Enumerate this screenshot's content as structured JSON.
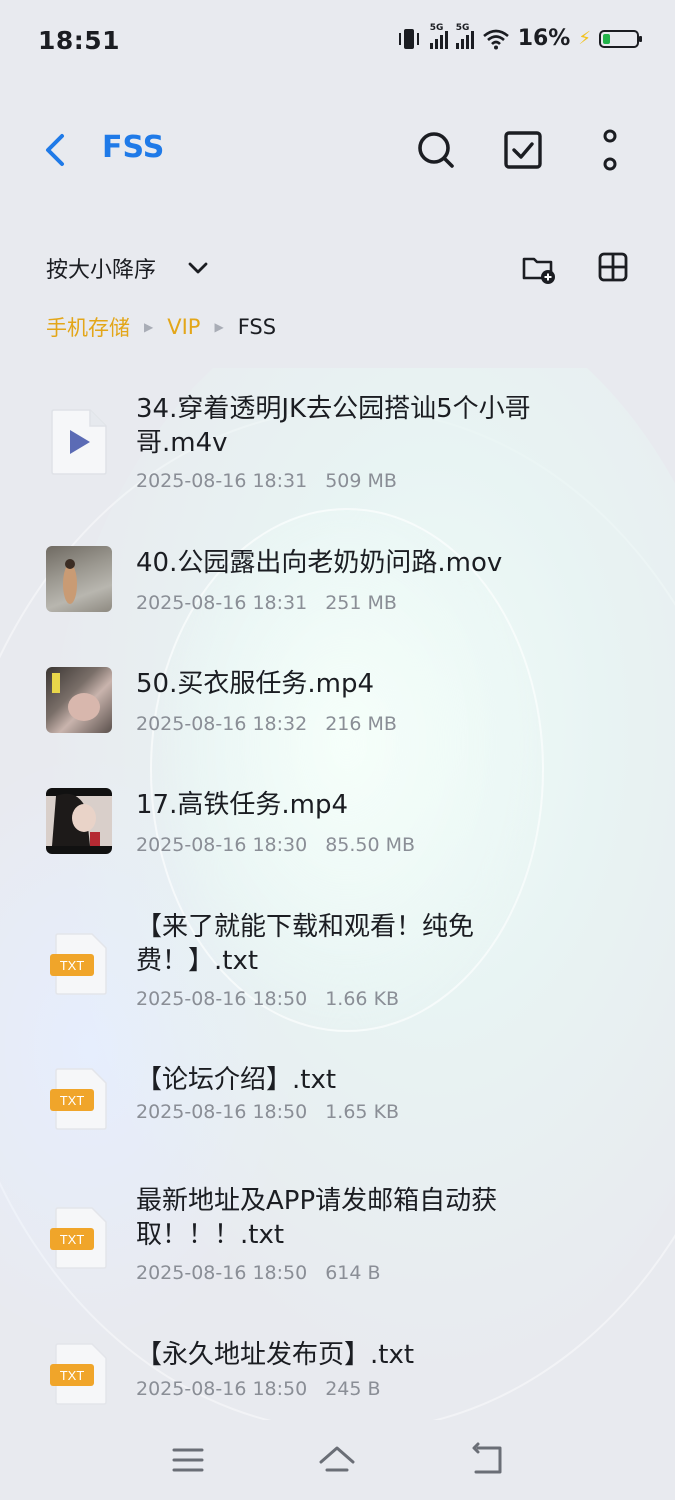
{
  "status": {
    "time": "18:51",
    "network1": "5G",
    "network2": "5G",
    "battery_percent": "16%",
    "battery_level": 0.16
  },
  "header": {
    "title": "FSS",
    "icons": [
      "back-icon",
      "search-icon",
      "select-checkbox-icon",
      "more-vertical-icon"
    ]
  },
  "toolbar": {
    "sort_label": "按大小降序",
    "icons": [
      "chevron-down-icon",
      "new-folder-icon",
      "grid-view-icon"
    ]
  },
  "breadcrumb": [
    {
      "label": "手机存储"
    },
    {
      "label": "VIP"
    },
    {
      "label": "FSS"
    }
  ],
  "files": [
    {
      "name": "34.穿着透明JK去公园搭讪5个小哥哥.m4v",
      "date": "2025-08-16 18:31",
      "size": "509 MB",
      "icon": "video-file-icon"
    },
    {
      "name": "40.公园露出向老奶奶问路.mov",
      "date": "2025-08-16 18:31",
      "size": "251 MB",
      "icon": "video-thumbnail"
    },
    {
      "name": "50.买衣服任务.mp4",
      "date": "2025-08-16 18:32",
      "size": "216 MB",
      "icon": "video-thumbnail"
    },
    {
      "name": "17.高铁任务.mp4",
      "date": "2025-08-16 18:30",
      "size": "85.50 MB",
      "icon": "video-thumbnail"
    },
    {
      "name": "【来了就能下载和观看！纯免费！】.txt",
      "date": "2025-08-16 18:50",
      "size": "1.66 KB",
      "icon": "txt-file-icon"
    },
    {
      "name": "【论坛介绍】.txt",
      "date": "2025-08-16 18:50",
      "size": "1.65 KB",
      "icon": "txt-file-icon"
    },
    {
      "name": "最新地址及APP请发邮箱自动获取！！！.txt",
      "date": "2025-08-16 18:50",
      "size": "614 B",
      "icon": "txt-file-icon"
    },
    {
      "name": "【永久地址发布页】.txt",
      "date": "2025-08-16 18:50",
      "size": "245 B",
      "icon": "txt-file-icon"
    }
  ],
  "txt_badge": "TXT",
  "nav": {
    "icons": [
      "menu-icon",
      "home-icon",
      "back-nav-icon"
    ]
  },
  "colors": {
    "accent": "#1f7ae8",
    "breadcrumb": "#e3a619",
    "txt_badge": "#f0a52a"
  }
}
